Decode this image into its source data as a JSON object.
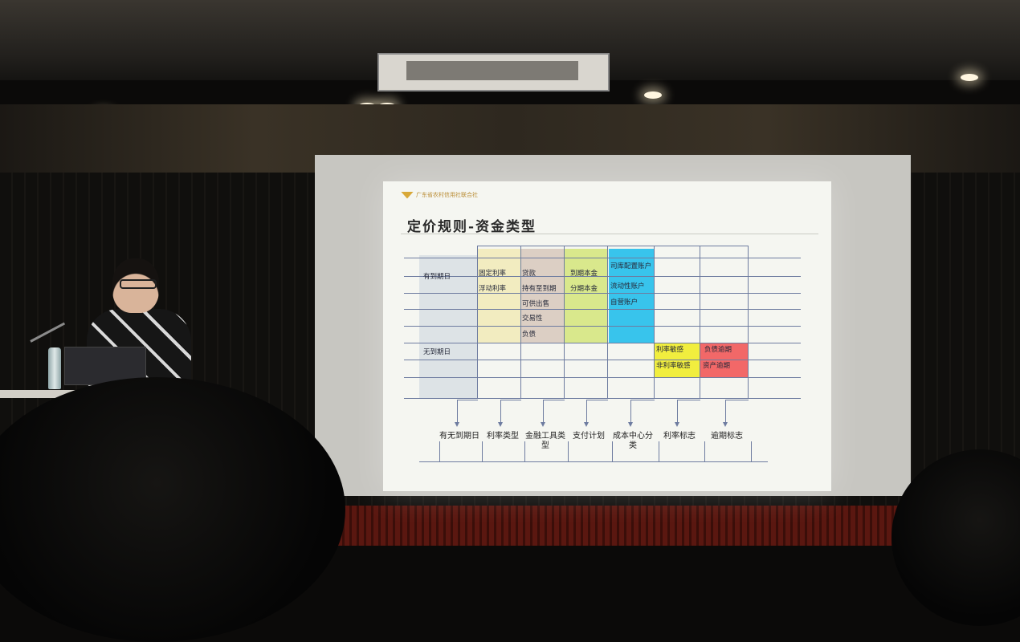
{
  "slide": {
    "logo_text": "广东省农村信用社联合社",
    "title": "定价规则-资金类型"
  },
  "table": {
    "rows": [
      {
        "label": "有到期日"
      },
      {
        "label": "无到期日"
      }
    ],
    "colored_blocks": [
      {
        "name": "interest-rate-type",
        "color": "#f2ecc0",
        "items": [
          "固定利率",
          "浮动利率"
        ]
      },
      {
        "name": "financial-instrument-type",
        "color": "#dccfc4",
        "items": [
          "贷款",
          "持有至到期",
          "可供出售",
          "交易性",
          "负债"
        ]
      },
      {
        "name": "payment-plan",
        "color": "#d9e88c",
        "items": [
          "到期本金",
          "分期本金"
        ]
      },
      {
        "name": "cost-center",
        "color": "#38c4ec",
        "items": [
          "司库配置账户",
          "流动性账户",
          "自营账户"
        ]
      },
      {
        "name": "rate-flag",
        "color": "#f1ee3e",
        "items": [
          "利率敏感",
          "非利率敏感"
        ]
      },
      {
        "name": "overdue-flag",
        "color": "#f26868",
        "items": [
          "负债逾期",
          "资产逾期"
        ]
      }
    ],
    "categories": [
      "有无到期日",
      "利率类型",
      "金融工具类型",
      "支付计划",
      "成本中心分类",
      "利率标志",
      "逾期标志"
    ]
  },
  "colors": {
    "slide_background": "#f5f6f1",
    "line": "#6e7ca0",
    "first_column": "#dde3e6"
  }
}
